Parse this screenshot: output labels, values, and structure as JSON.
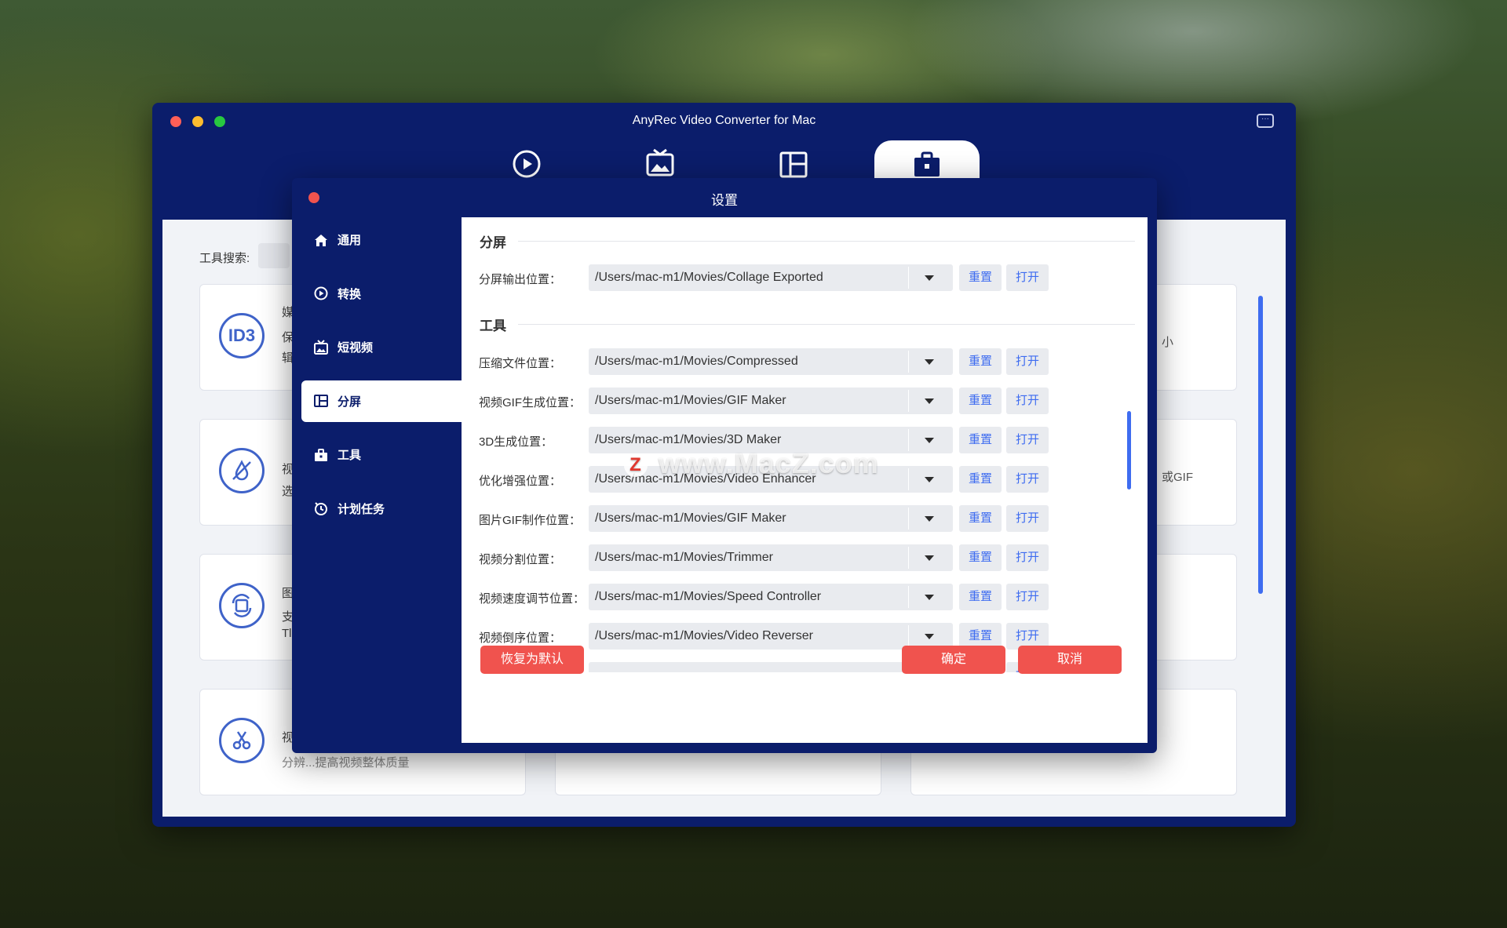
{
  "app": {
    "title": "AnyRec Video Converter for Mac",
    "tool_search_label": "工具搜索:",
    "card_peeks": [
      "媒",
      "保",
      "辑",
      "视",
      "选",
      "图",
      "支",
      "Tl",
      "视",
      "分辨...提高视频整体质量"
    ],
    "right_edge_text": [
      "小",
      "或GIF"
    ]
  },
  "dialog": {
    "title": "设置",
    "nav": [
      {
        "label": "通用",
        "icon": "home-icon"
      },
      {
        "label": "转换",
        "icon": "convert-icon"
      },
      {
        "label": "短视频",
        "icon": "mv-icon"
      },
      {
        "label": "分屏",
        "icon": "collage-icon"
      },
      {
        "label": "工具",
        "icon": "toolbox-icon"
      },
      {
        "label": "计划任务",
        "icon": "clock-icon"
      }
    ],
    "active_nav": "分屏",
    "sections": {
      "collage": "分屏",
      "tools": "工具"
    },
    "collage_rows": [
      {
        "label": "分屏输出位置：",
        "path": "/Users/mac-m1/Movies/Collage Exported"
      }
    ],
    "tool_rows": [
      {
        "label": "压缩文件位置：",
        "path": "/Users/mac-m1/Movies/Compressed"
      },
      {
        "label": "视频GIF生成位置：",
        "path": "/Users/mac-m1/Movies/GIF Maker"
      },
      {
        "label": "3D生成位置：",
        "path": "/Users/mac-m1/Movies/3D Maker"
      },
      {
        "label": "优化增强位置：",
        "path": "/Users/mac-m1/Movies/Video Enhancer"
      },
      {
        "label": "图片GIF制作位置：",
        "path": "/Users/mac-m1/Movies/GIF Maker"
      },
      {
        "label": "视频分割位置：",
        "path": "/Users/mac-m1/Movies/Trimmer"
      },
      {
        "label": "视频速度调节位置：",
        "path": "/Users/mac-m1/Movies/Speed Controller"
      },
      {
        "label": "视频倒序位置：",
        "path": "/Users/mac-m1/Movies/Video Reverser"
      },
      {
        "label": "",
        "path": ""
      }
    ],
    "reset_label": "重置",
    "open_label": "打开",
    "restore_default": "恢复为默认",
    "confirm": "确定",
    "cancel": "取消"
  },
  "watermark": "www.MacZ.com",
  "colors": {
    "navy": "#0b1d6b",
    "accent_blue": "#3e6cf0",
    "red": "#f0534e"
  }
}
